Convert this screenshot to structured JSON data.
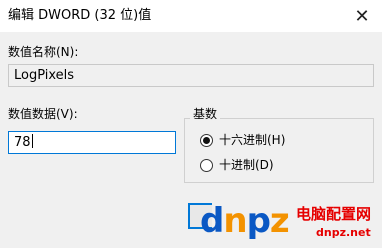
{
  "window": {
    "title": "编辑 DWORD (32 位)值",
    "close_glyph": "✕"
  },
  "dialog": {
    "value_name_label": "数值名称(N):",
    "value_name": "LogPixels",
    "value_data_label": "数值数据(V):",
    "value_data": "78",
    "base": {
      "title": "基数",
      "options": [
        {
          "label": "十六进制(H)",
          "selected": true
        },
        {
          "label": "十进制(D)",
          "selected": false
        }
      ]
    }
  },
  "watermark": {
    "brand": "dnpz",
    "brand_cn": "电脑配置网",
    "domain": "dnpz.net",
    "colors": {
      "blue": "#0a58c4",
      "orange": "#f39200",
      "red": "#e60000"
    }
  },
  "colors": {
    "accent": "#0078d7",
    "dialog_bg": "#f0f0f0"
  }
}
